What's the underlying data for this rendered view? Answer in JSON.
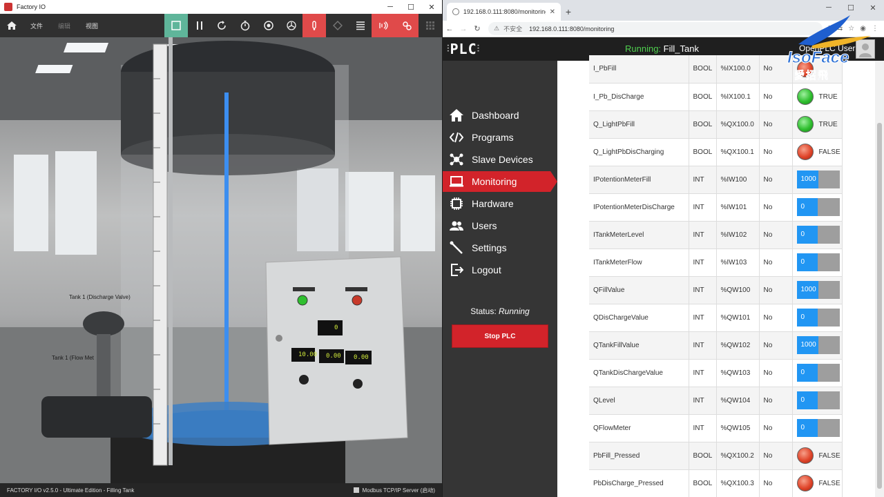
{
  "factoryio": {
    "window_title": "Factory IO",
    "menus": [
      "文件",
      "编辑",
      "视图"
    ],
    "scene_labels": {
      "discharge_valve": "Tank 1 (Discharge Valve)",
      "flow_meter": "Tank 1 (Flow Met"
    },
    "panel_displays": {
      "top": "0",
      "left": "10.00",
      "mid": "0.00",
      "right": "0.00"
    },
    "status_left": "FACTORY I/O v2.5.0 - Ultimate Edition - Filling Tank",
    "status_right": "Modbus TCP/IP Server (启动)",
    "colors": {
      "toolbar_green": "#5fb59a",
      "toolbar_red": "#e04a4a"
    },
    "toolbar_icons": [
      "home-icon",
      "select-icon",
      "pause-icon",
      "reset-icon",
      "timer-icon",
      "camera-icon",
      "fan-icon",
      "touch-icon",
      "grid-icon",
      "list-icon",
      "sensor-icon",
      "drivers-icon",
      "menu-icon"
    ]
  },
  "browser": {
    "tab_title": "192.168.0.111:8080/monitoring",
    "new_tab": "+",
    "security": "不安全",
    "url": "192.168.0.111:8080/monitoring"
  },
  "openplc": {
    "logo": "PLC",
    "running_label": "Running:",
    "running_program": "Fill_Tank",
    "user": "OpenPLC User",
    "nav": [
      {
        "label": "Dashboard",
        "icon": "home-icon"
      },
      {
        "label": "Programs",
        "icon": "code-icon"
      },
      {
        "label": "Slave Devices",
        "icon": "network-icon"
      },
      {
        "label": "Monitoring",
        "icon": "monitor-icon",
        "active": true
      },
      {
        "label": "Hardware",
        "icon": "chip-icon"
      },
      {
        "label": "Users",
        "icon": "users-icon"
      },
      {
        "label": "Settings",
        "icon": "wrench-icon"
      },
      {
        "label": "Logout",
        "icon": "logout-icon"
      }
    ],
    "status_label": "Status:",
    "status_value": "Running",
    "stop_button": "Stop PLC",
    "colors": {
      "accent": "#d2232a",
      "led_on": "#2fbf2f",
      "led_off": "#e0452a",
      "bar": "#2196f3"
    },
    "rows": [
      {
        "name": "I_PbFill",
        "type": "BOOL",
        "addr": "%IX100.0",
        "forced": "No",
        "kind": "led",
        "state": "off",
        "text": ""
      },
      {
        "name": "I_Pb_DisCharge",
        "type": "BOOL",
        "addr": "%IX100.1",
        "forced": "No",
        "kind": "led",
        "state": "on",
        "text": "TRUE"
      },
      {
        "name": "Q_LightPbFill",
        "type": "BOOL",
        "addr": "%QX100.0",
        "forced": "No",
        "kind": "led",
        "state": "on",
        "text": "TRUE"
      },
      {
        "name": "Q_LightPbDisCharging",
        "type": "BOOL",
        "addr": "%QX100.1",
        "forced": "No",
        "kind": "led",
        "state": "off",
        "text": "FALSE"
      },
      {
        "name": "IPotentionMeterFill",
        "type": "INT",
        "addr": "%IW100",
        "forced": "No",
        "kind": "bar",
        "value": "1000",
        "fill": 0.5
      },
      {
        "name": "IPotentionMeterDisCharge",
        "type": "INT",
        "addr": "%IW101",
        "forced": "No",
        "kind": "bar",
        "value": "0",
        "fill": 0.48
      },
      {
        "name": "ITankMeterLevel",
        "type": "INT",
        "addr": "%IW102",
        "forced": "No",
        "kind": "bar",
        "value": "0",
        "fill": 0.48
      },
      {
        "name": "ITankMeterFlow",
        "type": "INT",
        "addr": "%IW103",
        "forced": "No",
        "kind": "bar",
        "value": "0",
        "fill": 0.48
      },
      {
        "name": "QFillValue",
        "type": "INT",
        "addr": "%QW100",
        "forced": "No",
        "kind": "bar",
        "value": "1000",
        "fill": 0.5
      },
      {
        "name": "QDisChargeValue",
        "type": "INT",
        "addr": "%QW101",
        "forced": "No",
        "kind": "bar",
        "value": "0",
        "fill": 0.48
      },
      {
        "name": "QTankFillValue",
        "type": "INT",
        "addr": "%QW102",
        "forced": "No",
        "kind": "bar",
        "value": "1000",
        "fill": 0.5
      },
      {
        "name": "QTankDisChargeValue",
        "type": "INT",
        "addr": "%QW103",
        "forced": "No",
        "kind": "bar",
        "value": "0",
        "fill": 0.48
      },
      {
        "name": "QLevel",
        "type": "INT",
        "addr": "%QW104",
        "forced": "No",
        "kind": "bar",
        "value": "0",
        "fill": 0.48
      },
      {
        "name": "QFlowMeter",
        "type": "INT",
        "addr": "%QW105",
        "forced": "No",
        "kind": "bar",
        "value": "0",
        "fill": 0.48
      },
      {
        "name": "PbFill_Pressed",
        "type": "BOOL",
        "addr": "%QX100.2",
        "forced": "No",
        "kind": "led",
        "state": "off",
        "text": "FALSE"
      },
      {
        "name": "PbDisCharge_Pressed",
        "type": "BOOL",
        "addr": "%QX100.3",
        "forced": "No",
        "kind": "led",
        "state": "off",
        "text": "FALSE"
      }
    ]
  },
  "watermark": {
    "line1": "IsoFace",
    "line2": "愛招飛"
  }
}
